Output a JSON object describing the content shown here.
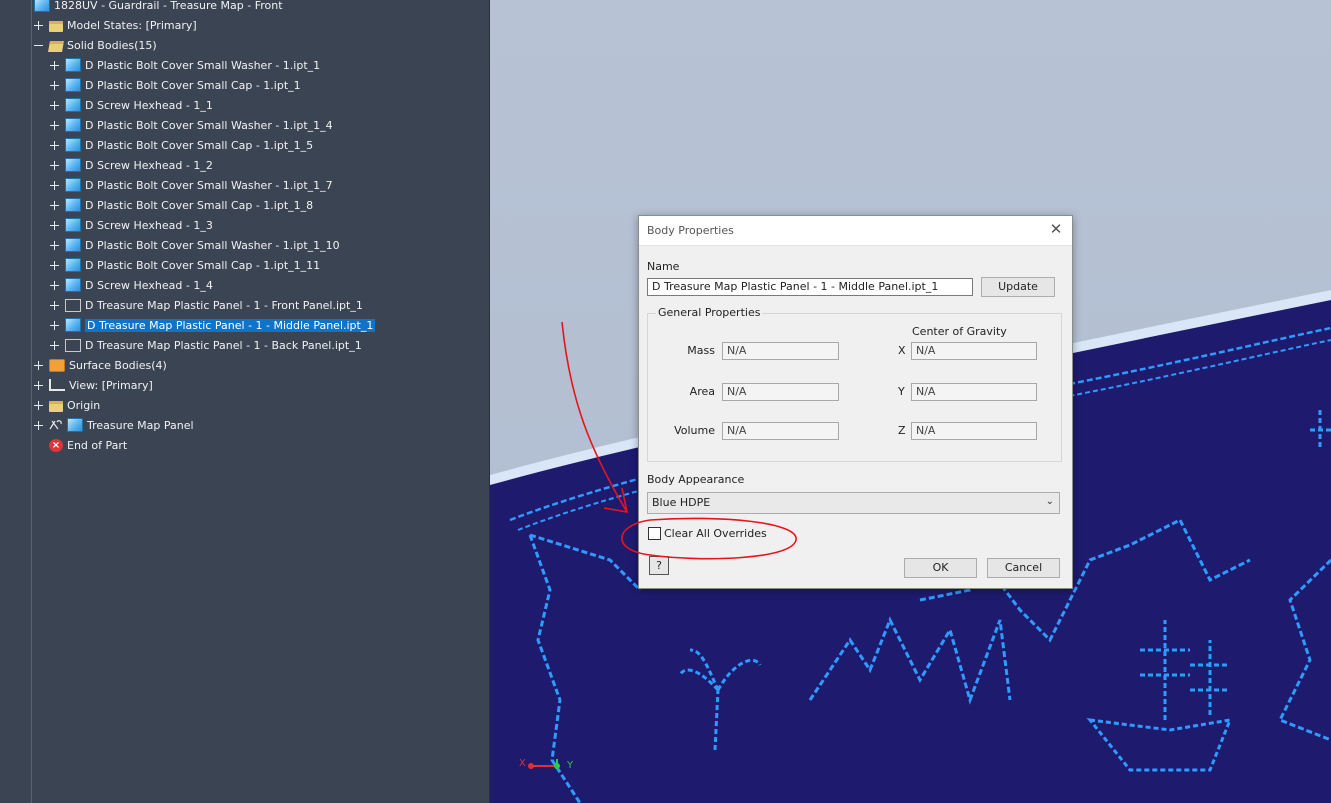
{
  "browser": {
    "root_title": "1828UV - Guardrail - Treasure Map - Front",
    "items": [
      {
        "label": "Model States: [Primary]"
      },
      {
        "label": "Solid Bodies(15)"
      },
      {
        "label": "D Plastic Bolt Cover Small Washer - 1.ipt_1"
      },
      {
        "label": "D Plastic Bolt Cover Small Cap - 1.ipt_1"
      },
      {
        "label": "D Screw Hexhead - 1_1"
      },
      {
        "label": "D Plastic Bolt Cover Small Washer - 1.ipt_1_4"
      },
      {
        "label": "D Plastic Bolt Cover Small Cap - 1.ipt_1_5"
      },
      {
        "label": "D Screw Hexhead - 1_2"
      },
      {
        "label": "D Plastic Bolt Cover Small Washer - 1.ipt_1_7"
      },
      {
        "label": "D Plastic Bolt Cover Small Cap - 1.ipt_1_8"
      },
      {
        "label": "D Screw Hexhead - 1_3"
      },
      {
        "label": "D Plastic Bolt Cover Small Washer - 1.ipt_1_10"
      },
      {
        "label": "D Plastic Bolt Cover Small Cap - 1.ipt_1_11"
      },
      {
        "label": "D Screw Hexhead - 1_4"
      },
      {
        "label": "D Treasure Map Plastic Panel - 1 - Front Panel.ipt_1"
      },
      {
        "label": "D Treasure Map Plastic Panel - 1 - Middle Panel.ipt_1"
      },
      {
        "label": "D Treasure Map Plastic Panel - 1 - Back Panel.ipt_1"
      },
      {
        "label": "Surface Bodies(4)"
      },
      {
        "label": "View: [Primary]"
      },
      {
        "label": "Origin"
      },
      {
        "label": "Treasure Map Panel"
      },
      {
        "label": "End of Part"
      }
    ]
  },
  "dialog": {
    "title": "Body Properties",
    "name_label": "Name",
    "name_value": "D Treasure Map Plastic Panel - 1 - Middle Panel.ipt_1",
    "update_label": "Update",
    "general_label": "General Properties",
    "cog_label": "Center of Gravity",
    "mass_label": "Mass",
    "mass_value": "N/A",
    "area_label": "Area",
    "area_value": "N/A",
    "volume_label": "Volume",
    "volume_value": "N/A",
    "x_label": "X",
    "x_value": "N/A",
    "y_label": "Y",
    "y_value": "N/A",
    "z_label": "Z",
    "z_value": "N/A",
    "appearance_label": "Body Appearance",
    "appearance_value": "Blue HDPE",
    "clear_overrides_label": "Clear All Overrides",
    "help_label": "?",
    "ok_label": "OK",
    "cancel_label": "Cancel"
  },
  "triad": {
    "x_label": "X",
    "y_label": "Y"
  },
  "colors": {
    "browser_bg": "#3b4453",
    "selected": "#0d74c9",
    "panel_blue": "#1e1b6e",
    "outline_blue": "#2f9bff",
    "annotation_red": "#e8141b",
    "background_top": "#b7c3d5"
  }
}
